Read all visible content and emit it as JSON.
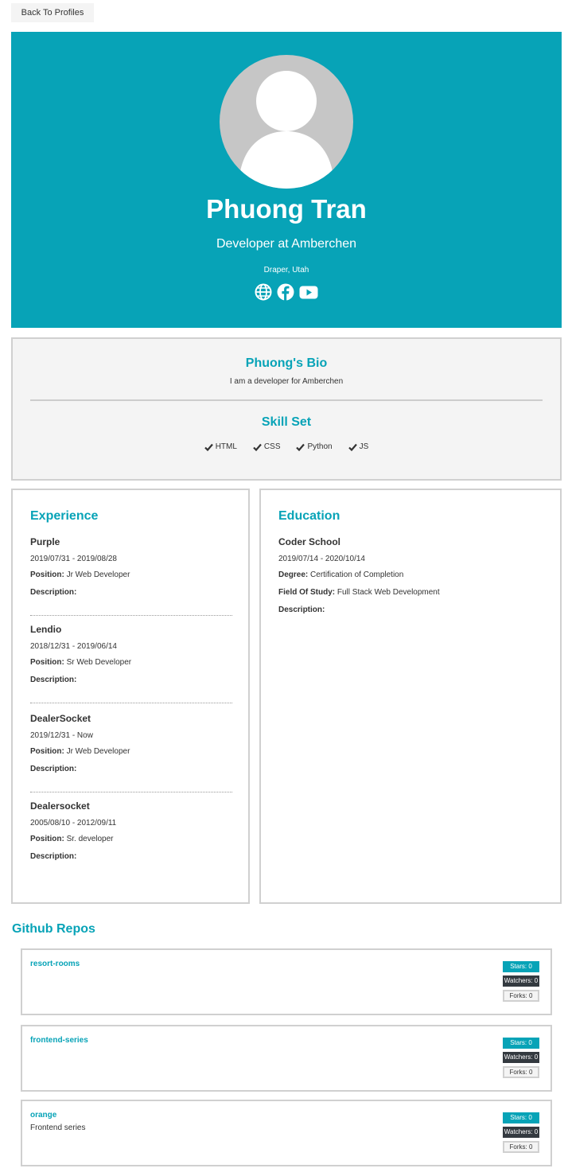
{
  "nav": {
    "back_label": "Back To Profiles"
  },
  "profile": {
    "name": "Phuong Tran",
    "status": "Developer at Amberchen",
    "location": "Draper, Utah",
    "social_icons": [
      "globe-icon",
      "facebook-icon",
      "youtube-icon"
    ]
  },
  "bio": {
    "title": "Phuong's Bio",
    "text": "I am a developer for Amberchen",
    "skills_title": "Skill Set",
    "skills": [
      "HTML",
      "CSS",
      "Python",
      "JS"
    ]
  },
  "experience": {
    "title": "Experience",
    "position_label": "Position:",
    "description_label": "Description:",
    "items": [
      {
        "company": "Purple",
        "dates": "2019/07/31 - 2019/08/28",
        "position": "Jr Web Developer"
      },
      {
        "company": "Lendio",
        "dates": "2018/12/31 - 2019/06/14",
        "position": "Sr Web Developer"
      },
      {
        "company": "DealerSocket",
        "dates": "2019/12/31 - Now",
        "position": "Jr Web Developer"
      },
      {
        "company": "Dealersocket",
        "dates": "2005/08/10 - 2012/09/11",
        "position": "Sr. developer"
      }
    ]
  },
  "education": {
    "title": "Education",
    "school": "Coder School",
    "dates": "2019/07/14 - 2020/10/14",
    "degree_label": "Degree:",
    "degree": "Certification of Completion",
    "field_label": "Field Of Study:",
    "field": "Full Stack Web Development",
    "description_label": "Description:"
  },
  "repos": {
    "title": "Github Repos",
    "items": [
      {
        "name": "resort-rooms",
        "description": "",
        "stars": "Stars: 0",
        "watchers": "Watchers: 0",
        "forks": "Forks: 0"
      },
      {
        "name": "frontend-series",
        "description": "",
        "stars": "Stars: 0",
        "watchers": "Watchers: 0",
        "forks": "Forks: 0"
      },
      {
        "name": "orange",
        "description": "Frontend series",
        "stars": "Stars: 0",
        "watchers": "Watchers: 0",
        "forks": "Forks: 0"
      }
    ]
  },
  "colors": {
    "primary": "#07a3b7",
    "light": "#f4f4f4",
    "dark": "#343a40",
    "border": "#d0d0d0"
  }
}
